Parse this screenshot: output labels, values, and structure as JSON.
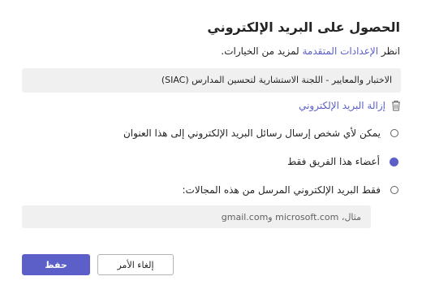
{
  "dialog": {
    "title": "الحصول على البريد الإلكتروني",
    "description_prefix": "انظر ",
    "description_link": "الإعدادات المتقدمة",
    "description_suffix": " لمزيد من الخيارات.",
    "channel_name": "الاختبار والمعايير - اللجنة الاستشارية لتحسين المدارس (SIAC)",
    "remove_email_label": "إزالة البريد الإلكتروني",
    "remove_icon": "trash-icon",
    "options": [
      {
        "label": "يمكن لأي شخص إرسال رسائل البريد الإلكتروني إلى هذا العنوان",
        "selected": false
      },
      {
        "label": "أعضاء هذا الفريق فقط",
        "selected": true
      },
      {
        "label": "فقط البريد الإلكتروني المرسل من هذه المجالات:",
        "selected": false
      }
    ],
    "domains_input": {
      "value": "",
      "placeholder": "مثال، microsoft.com وgmail.com"
    },
    "cancel_label": "إلغاء الأمر",
    "save_label": "حفظ",
    "accent_color": "#5b5fc7"
  }
}
